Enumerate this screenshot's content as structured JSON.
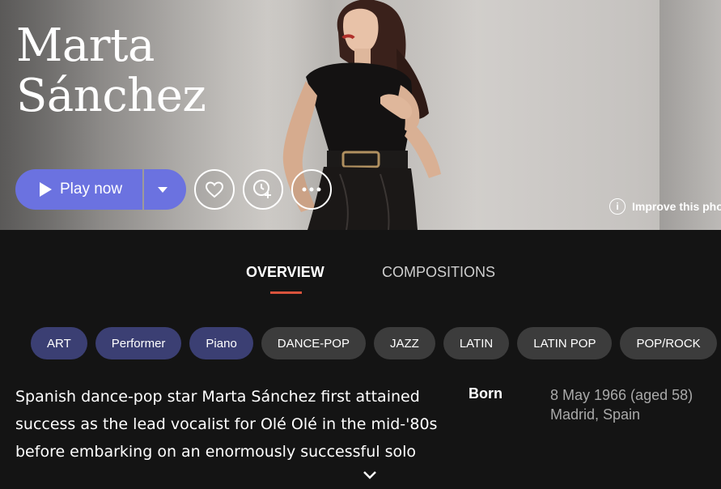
{
  "artist": {
    "name_line1": "Marta",
    "name_line2": "Sánchez"
  },
  "actions": {
    "play_label": "Play now",
    "favorite_icon": "heart-icon",
    "add_to_queue_icon": "clock-plus-icon",
    "more_icon": "more-dots-icon"
  },
  "improve_photo": {
    "label": "Improve this pho",
    "icon": "info-icon"
  },
  "tabs": [
    {
      "label": "OVERVIEW",
      "active": true
    },
    {
      "label": "COMPOSITIONS",
      "active": false
    }
  ],
  "chips": [
    {
      "label": "ART",
      "kind": "role"
    },
    {
      "label": "Performer",
      "kind": "role"
    },
    {
      "label": "Piano",
      "kind": "role"
    },
    {
      "label": "DANCE-POP",
      "kind": "genre"
    },
    {
      "label": "JAZZ",
      "kind": "genre"
    },
    {
      "label": "LATIN",
      "kind": "genre"
    },
    {
      "label": "LATIN POP",
      "kind": "genre"
    },
    {
      "label": "POP/ROCK",
      "kind": "genre"
    }
  ],
  "bio": {
    "lines": [
      "Spanish dance-pop star Marta Sánchez first attained",
      "success as the lead vocalist for Olé Olé in the mid-'80s",
      "before embarking on an enormously successful solo"
    ],
    "expand_icon": "chevron-down-icon"
  },
  "born": {
    "label": "Born",
    "date": "8 May 1966 (aged 58)",
    "place": "Madrid, Spain"
  },
  "colors": {
    "accent": "#6b72e0",
    "tab_underline": "#d9533c",
    "role_chip": "#3b3f73",
    "genre_chip": "#3c3c3c",
    "background": "#141414"
  }
}
